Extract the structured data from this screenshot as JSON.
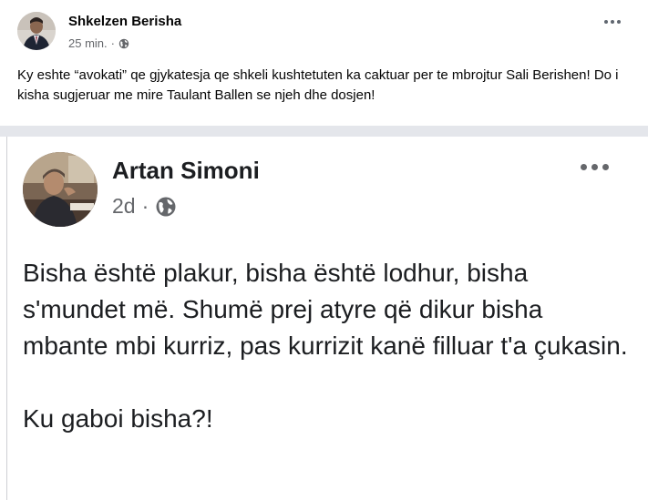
{
  "outer_post": {
    "author": "Shkelzen Berisha",
    "time": "25 min.",
    "separator": "·",
    "text": "Ky eshte “avokati” qe gjykatesja qe shkeli kushtetuten ka caktuar per te mbrojtur Sali Berishen! Do i kisha sugjeruar me mire Taulant Ballen se njeh dhe dosjen!",
    "privacy_icon": "globe-icon",
    "more_icon": "more-options-icon"
  },
  "shared_post": {
    "author": "Artan Simoni",
    "time": "2d",
    "separator": "·",
    "privacy_icon": "globe-icon",
    "more_icon": "more-options-icon",
    "paragraph_1": "Bisha është plakur, bisha është lodhur, bisha s'mundet më. Shumë prej atyre që dikur bisha mbante mbi kurriz, pas kurrizit kanë filluar t'a çukasin.",
    "paragraph_2": "Ku gaboi bisha?!"
  },
  "colors": {
    "divider": "#e4e6eb",
    "meta": "#65676b",
    "text": "#050505"
  }
}
